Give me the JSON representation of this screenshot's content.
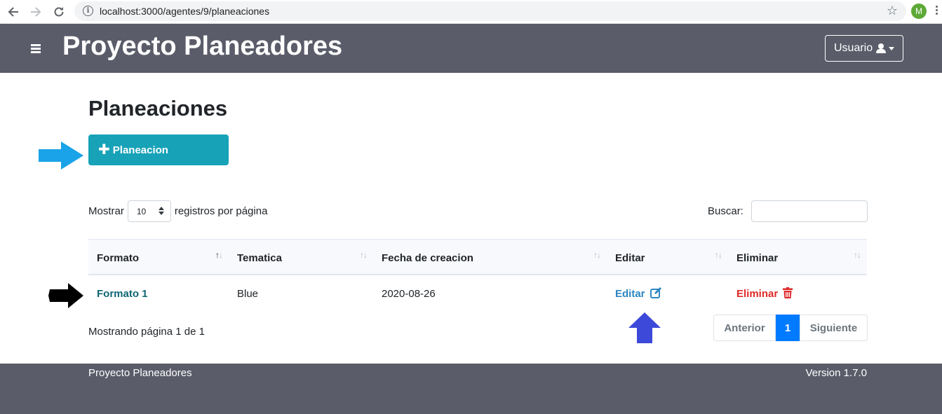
{
  "browser": {
    "url": "localhost:3000/agentes/9/planeaciones",
    "profile_initial": "M"
  },
  "navbar": {
    "title": "Proyecto Planeadores",
    "user_label": "Usuario"
  },
  "main": {
    "page_title": "Planeaciones",
    "add_button_label": "Planeacion",
    "length_prefix": "Mostrar",
    "length_value": "10",
    "length_suffix": "registros por página",
    "search_label": "Buscar:",
    "search_value": "",
    "table": {
      "columns": [
        "Formato",
        "Tematica",
        "Fecha de creacion",
        "Editar",
        "Eliminar"
      ],
      "rows": [
        {
          "formato": "Formato 1",
          "tematica": "Blue",
          "fecha": "2020-08-26",
          "editar": "Editar",
          "eliminar": "Eliminar"
        }
      ]
    },
    "info": "Mostrando página 1 de 1",
    "pagination": {
      "prev": "Anterior",
      "current": "1",
      "next": "Siguiente"
    }
  },
  "footer": {
    "left": "Proyecto Planeadores",
    "right": "Version 1.7.0"
  },
  "colors": {
    "navbar": "#5a5c69",
    "add_button": "#17a2b8",
    "active_page": "#007bff",
    "edit_link": "#2e86c1",
    "delete_link": "#e02828",
    "arrow_cyan": "#1aa3e8",
    "arrow_black": "#000000",
    "arrow_blue": "#3d49d9"
  }
}
